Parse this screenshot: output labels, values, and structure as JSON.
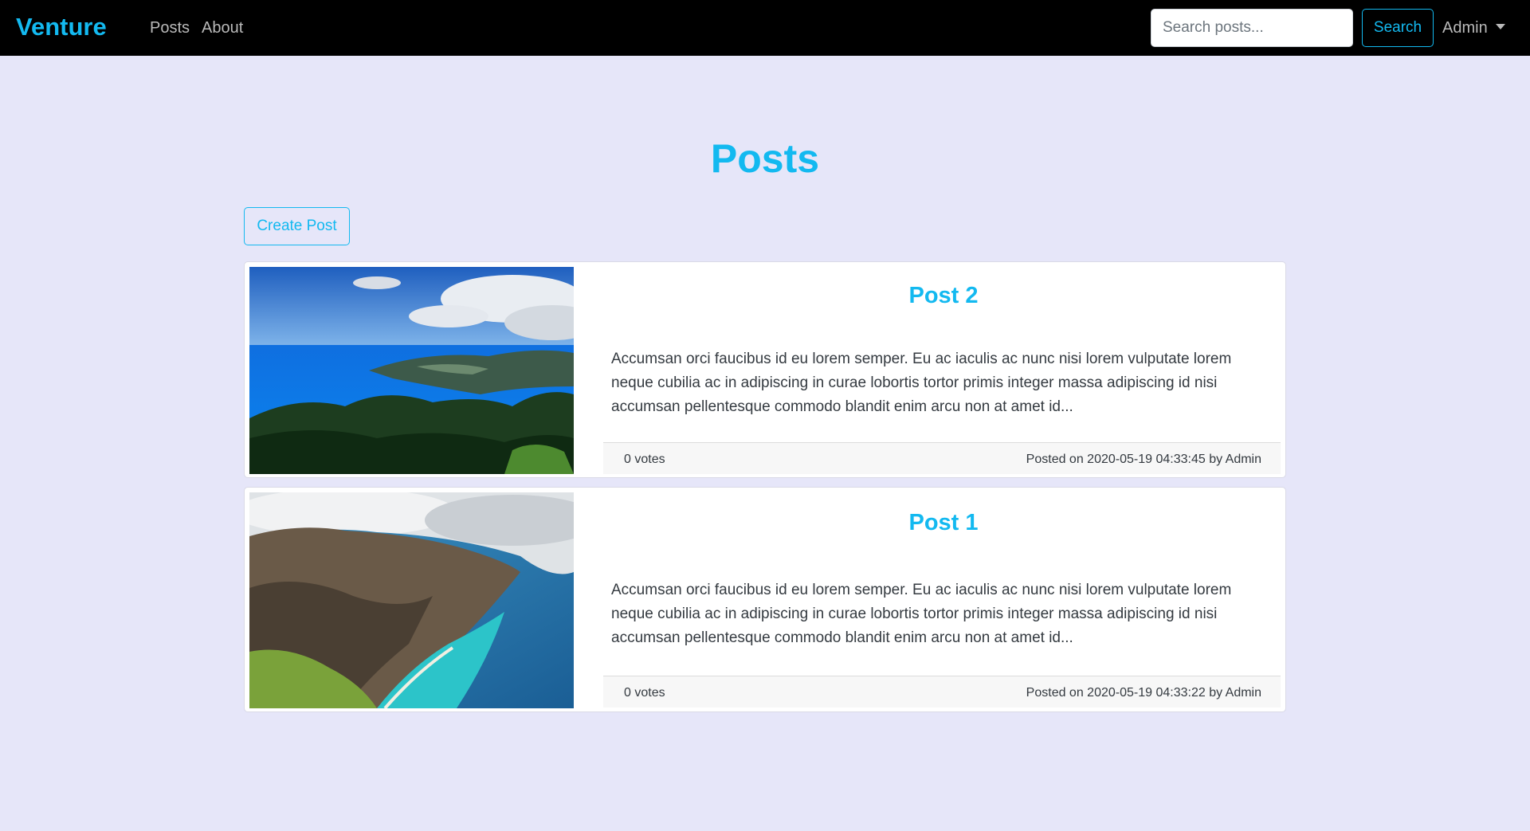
{
  "navbar": {
    "brand": "Venture",
    "links": [
      "Posts",
      "About"
    ],
    "search_placeholder": "Search posts...",
    "search_button": "Search",
    "user_menu": "Admin"
  },
  "main": {
    "title": "Posts",
    "create_button": "Create Post",
    "posts": [
      {
        "title": "Post 2",
        "excerpt": "Accumsan orci faucibus id eu lorem semper. Eu ac iaculis ac nunc nisi lorem vulputate lorem neque cubilia ac in adipiscing in curae lobortis tortor primis integer massa adipiscing id nisi accumsan pellentesque commodo blandit enim arcu non at amet id...",
        "votes": "0 votes",
        "posted": "Posted on 2020-05-19 04:33:45 by Admin"
      },
      {
        "title": "Post 1",
        "excerpt": "Accumsan orci faucibus id eu lorem semper. Eu ac iaculis ac nunc nisi lorem vulputate lorem neque cubilia ac in adipiscing in curae lobortis tortor primis integer massa adipiscing id nisi accumsan pellentesque commodo blandit enim arcu non at amet id...",
        "votes": "0 votes",
        "posted": "Posted on 2020-05-19 04:33:22 by Admin"
      }
    ]
  },
  "colors": {
    "accent": "#13b9f0",
    "navbar_bg": "#000000",
    "page_bg": "#e6e6f9"
  }
}
